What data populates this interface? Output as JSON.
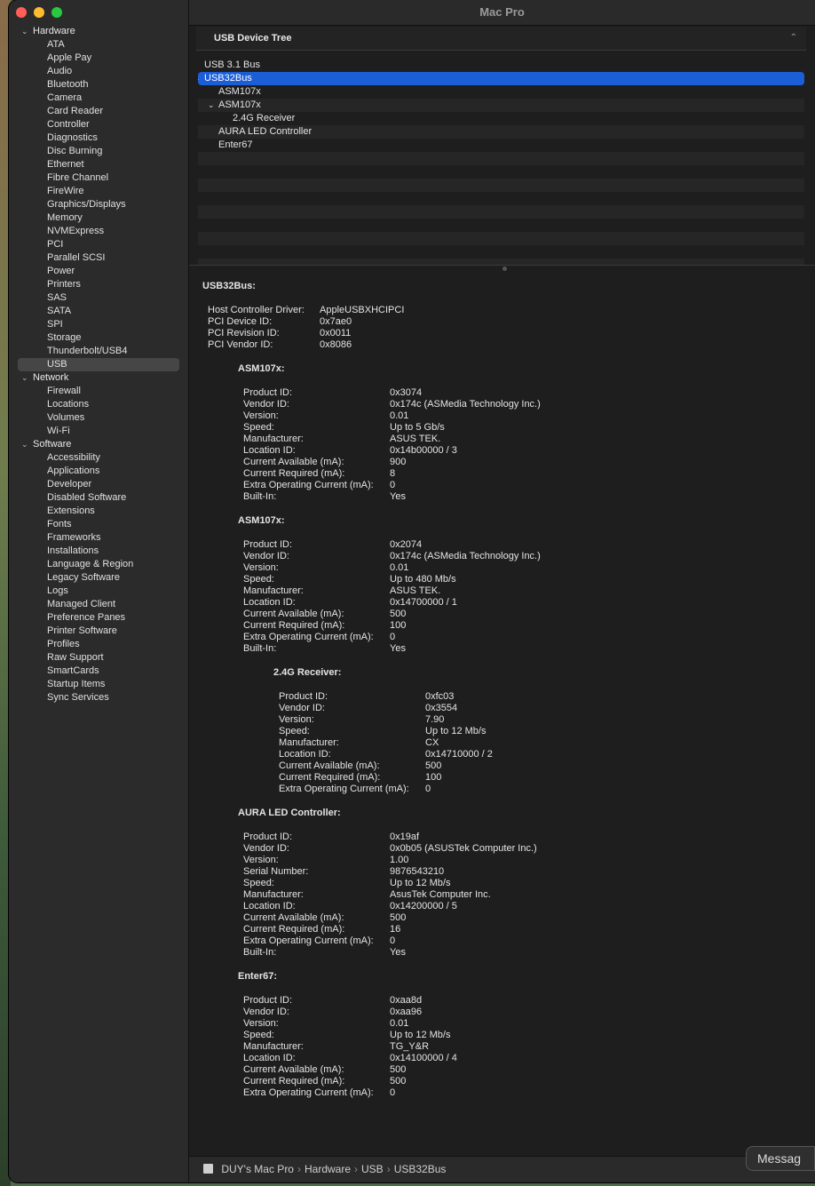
{
  "window": {
    "title": "Mac Pro"
  },
  "sidebar": {
    "sections": [
      {
        "label": "Hardware",
        "items": [
          "ATA",
          "Apple Pay",
          "Audio",
          "Bluetooth",
          "Camera",
          "Card Reader",
          "Controller",
          "Diagnostics",
          "Disc Burning",
          "Ethernet",
          "Fibre Channel",
          "FireWire",
          "Graphics/Displays",
          "Memory",
          "NVMExpress",
          "PCI",
          "Parallel SCSI",
          "Power",
          "Printers",
          "SAS",
          "SATA",
          "SPI",
          "Storage",
          "Thunderbolt/USB4",
          "USB"
        ]
      },
      {
        "label": "Network",
        "items": [
          "Firewall",
          "Locations",
          "Volumes",
          "Wi-Fi"
        ]
      },
      {
        "label": "Software",
        "items": [
          "Accessibility",
          "Applications",
          "Developer",
          "Disabled Software",
          "Extensions",
          "Fonts",
          "Frameworks",
          "Installations",
          "Language & Region",
          "Legacy Software",
          "Logs",
          "Managed Client",
          "Preference Panes",
          "Printer Software",
          "Profiles",
          "Raw Support",
          "SmartCards",
          "Startup Items",
          "Sync Services"
        ]
      }
    ],
    "selected": "USB"
  },
  "tree": {
    "header": "USB Device Tree",
    "rows": [
      {
        "label": "USB 3.1 Bus",
        "level": 0,
        "disclosure": ""
      },
      {
        "label": "USB32Bus",
        "level": 0,
        "disclosure": "open",
        "selected": true
      },
      {
        "label": "ASM107x",
        "level": 1,
        "disclosure": ""
      },
      {
        "label": "ASM107x",
        "level": 1,
        "disclosure": "open"
      },
      {
        "label": "2.4G Receiver",
        "level": 2,
        "disclosure": ""
      },
      {
        "label": "AURA LED Controller",
        "level": 1,
        "disclosure": ""
      },
      {
        "label": "Enter67",
        "level": 1,
        "disclosure": ""
      }
    ],
    "empty_rows": 9
  },
  "detail": {
    "title": "USB32Bus:",
    "bus_props": [
      [
        "Host Controller Driver:",
        "AppleUSBXHCIPCI"
      ],
      [
        "PCI Device ID:",
        "0x7ae0"
      ],
      [
        "PCI Revision ID:",
        "0x0011"
      ],
      [
        "PCI Vendor ID:",
        "0x8086"
      ]
    ],
    "devices": [
      {
        "name": "ASM107x:",
        "level": 1,
        "props": [
          [
            "Product ID:",
            "0x3074"
          ],
          [
            "Vendor ID:",
            "0x174c  (ASMedia Technology Inc.)"
          ],
          [
            "Version:",
            "0.01"
          ],
          [
            "Speed:",
            "Up to 5 Gb/s"
          ],
          [
            "Manufacturer:",
            "ASUS TEK."
          ],
          [
            "Location ID:",
            "0x14b00000 / 3"
          ],
          [
            "Current Available (mA):",
            "900"
          ],
          [
            "Current Required (mA):",
            "8"
          ],
          [
            "Extra Operating Current (mA):",
            "0"
          ],
          [
            "Built-In:",
            "Yes"
          ]
        ]
      },
      {
        "name": "ASM107x:",
        "level": 1,
        "props": [
          [
            "Product ID:",
            "0x2074"
          ],
          [
            "Vendor ID:",
            "0x174c  (ASMedia Technology Inc.)"
          ],
          [
            "Version:",
            "0.01"
          ],
          [
            "Speed:",
            "Up to 480 Mb/s"
          ],
          [
            "Manufacturer:",
            "ASUS TEK."
          ],
          [
            "Location ID:",
            "0x14700000 / 1"
          ],
          [
            "Current Available (mA):",
            "500"
          ],
          [
            "Current Required (mA):",
            "100"
          ],
          [
            "Extra Operating Current (mA):",
            "0"
          ],
          [
            "Built-In:",
            "Yes"
          ]
        ]
      },
      {
        "name": "2.4G Receiver:",
        "level": 2,
        "props": [
          [
            "Product ID:",
            "0xfc03"
          ],
          [
            "Vendor ID:",
            "0x3554"
          ],
          [
            "Version:",
            "7.90"
          ],
          [
            "Speed:",
            "Up to 12 Mb/s"
          ],
          [
            "Manufacturer:",
            "CX"
          ],
          [
            "Location ID:",
            "0x14710000 / 2"
          ],
          [
            "Current Available (mA):",
            "500"
          ],
          [
            "Current Required (mA):",
            "100"
          ],
          [
            "Extra Operating Current (mA):",
            "0"
          ]
        ]
      },
      {
        "name": "AURA LED Controller:",
        "level": 1,
        "props": [
          [
            "Product ID:",
            "0x19af"
          ],
          [
            "Vendor ID:",
            "0x0b05  (ASUSTek Computer Inc.)"
          ],
          [
            "Version:",
            "1.00"
          ],
          [
            "Serial Number:",
            "9876543210"
          ],
          [
            "Speed:",
            "Up to 12 Mb/s"
          ],
          [
            "Manufacturer:",
            "AsusTek Computer Inc."
          ],
          [
            "Location ID:",
            "0x14200000 / 5"
          ],
          [
            "Current Available (mA):",
            "500"
          ],
          [
            "Current Required (mA):",
            "16"
          ],
          [
            "Extra Operating Current (mA):",
            "0"
          ],
          [
            "Built-In:",
            "Yes"
          ]
        ]
      },
      {
        "name": "Enter67:",
        "level": 1,
        "props": [
          [
            "Product ID:",
            "0xaa8d"
          ],
          [
            "Vendor ID:",
            "0xaa96"
          ],
          [
            "Version:",
            "0.01"
          ],
          [
            "Speed:",
            "Up to 12 Mb/s"
          ],
          [
            "Manufacturer:",
            "TG_Y&R"
          ],
          [
            "Location ID:",
            "0x14100000 / 4"
          ],
          [
            "Current Available (mA):",
            "500"
          ],
          [
            "Current Required (mA):",
            "500"
          ],
          [
            "Extra Operating Current (mA):",
            "0"
          ]
        ]
      }
    ]
  },
  "breadcrumb": [
    "DUY's Mac Pro",
    "Hardware",
    "USB",
    "USB32Bus"
  ],
  "breadcrumb_separator": "›",
  "overlay": {
    "label": "Messag"
  },
  "icons": {
    "disclosure_open": "⌄",
    "collapse_header": "⌃"
  },
  "colors": {
    "selection": "#1b5ed8",
    "close": "#ff5f57",
    "minimize": "#febc2e",
    "zoom": "#28c840"
  }
}
